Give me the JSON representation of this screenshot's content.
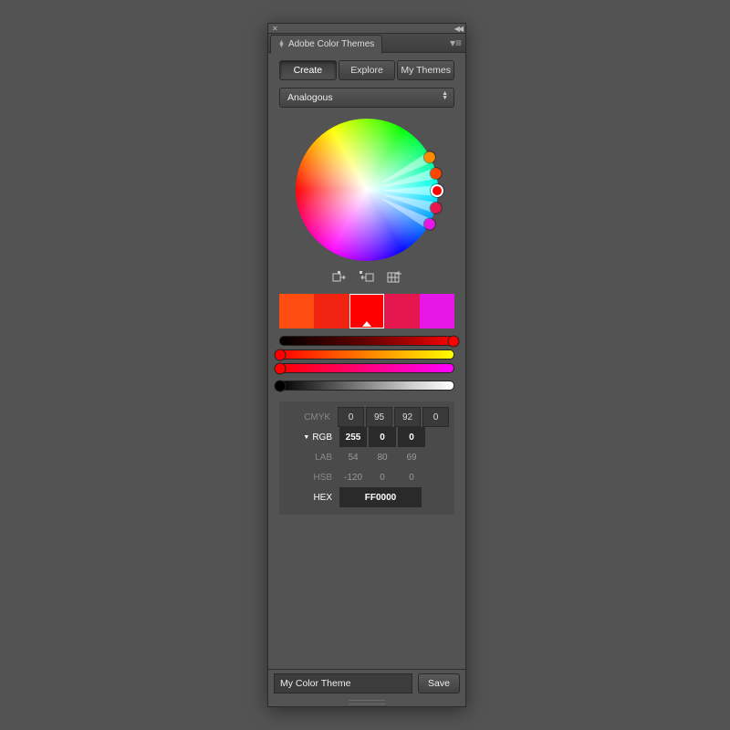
{
  "panel": {
    "title": "Adobe Color Themes"
  },
  "tabs": [
    {
      "label": "Create",
      "active": true
    },
    {
      "label": "Explore",
      "active": false
    },
    {
      "label": "My Themes",
      "active": false
    }
  ],
  "rule": {
    "selected": "Analogous"
  },
  "wheel": {
    "markers": [
      {
        "angle": -28,
        "color": "#ff8a00",
        "base": false
      },
      {
        "angle": -14,
        "color": "#ff4400",
        "base": false
      },
      {
        "angle": 0,
        "color": "#ff0000",
        "base": true
      },
      {
        "angle": 14,
        "color": "#e6174f",
        "base": false
      },
      {
        "angle": 28,
        "color": "#e617e6",
        "base": false
      }
    ]
  },
  "action_icons": {
    "a": "set-active-from-color-icon",
    "b": "set-color-from-active-icon",
    "c": "add-to-swatches-icon"
  },
  "swatches": [
    {
      "hex": "#ff4d12",
      "active": false
    },
    {
      "hex": "#f02410",
      "active": false
    },
    {
      "hex": "#ff0000",
      "active": true
    },
    {
      "hex": "#e6174f",
      "active": false
    },
    {
      "hex": "#e617e6",
      "active": false
    }
  ],
  "sliders": {
    "r": {
      "value": 255,
      "thumb_pct": 100,
      "bg": "linear-gradient(90deg,#000,#300,#600,#a00,#f00)",
      "thumb_color": "#ff0000"
    },
    "g": {
      "value": 0,
      "thumb_pct": 0,
      "bg": "linear-gradient(90deg,#ff0000,#ff4000,#ff8000,#ffc000,#ffff00)",
      "thumb_color": "#ff0000"
    },
    "b": {
      "value": 0,
      "thumb_pct": 0,
      "bg": "linear-gradient(90deg,#ff0000,#ff0040,#ff0080,#ff00c0,#ff00ff)",
      "thumb_color": "#ff0000"
    },
    "brightness": {
      "value": 0,
      "thumb_pct": 0,
      "bg": "linear-gradient(90deg,#000,#444,#888,#ccc,#fff)",
      "thumb_color": "#000000"
    }
  },
  "values": {
    "cmyk": {
      "label": "CMYK",
      "c": "0",
      "m": "95",
      "y": "92",
      "k": "0"
    },
    "rgb": {
      "label": "RGB",
      "r": "255",
      "g": "0",
      "b": "0"
    },
    "lab": {
      "label": "LAB",
      "l": "54",
      "a": "80",
      "b2": "69"
    },
    "hsb": {
      "label": "HSB",
      "h": "-120",
      "s": "0",
      "b3": "0"
    },
    "hex": {
      "label": "HEX",
      "value": "FF0000"
    }
  },
  "footer": {
    "theme_name": "My Color Theme",
    "save_label": "Save"
  }
}
